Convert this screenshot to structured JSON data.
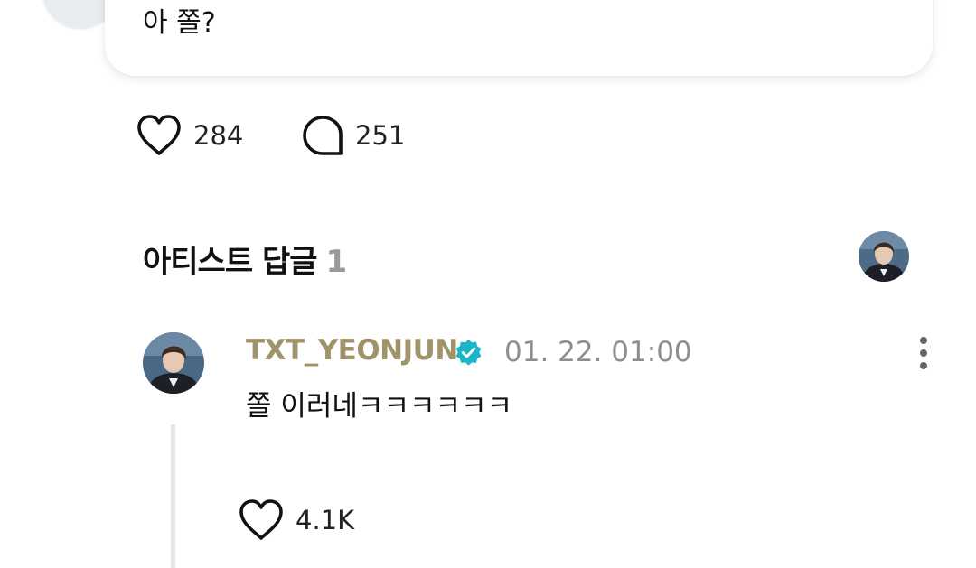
{
  "post": {
    "text": "아 쫄?",
    "likes": "284",
    "comments": "251"
  },
  "artist_replies": {
    "title": "아티스트 답글",
    "count": "1"
  },
  "reply": {
    "author": "TXT_YEONJUN",
    "timestamp": "01. 22. 01:00",
    "text": "쫄 이러네ㅋㅋㅋㅋㅋㅋ",
    "likes": "4.1K"
  },
  "colors": {
    "author_gold": "#a0936a",
    "verified": "#18b6c8",
    "muted": "#8e8e8e"
  },
  "icons": {
    "like": "heart-outline-icon",
    "comment": "chat-bubble-icon",
    "verified": "verified-badge-icon",
    "more": "more-vertical-icon"
  }
}
